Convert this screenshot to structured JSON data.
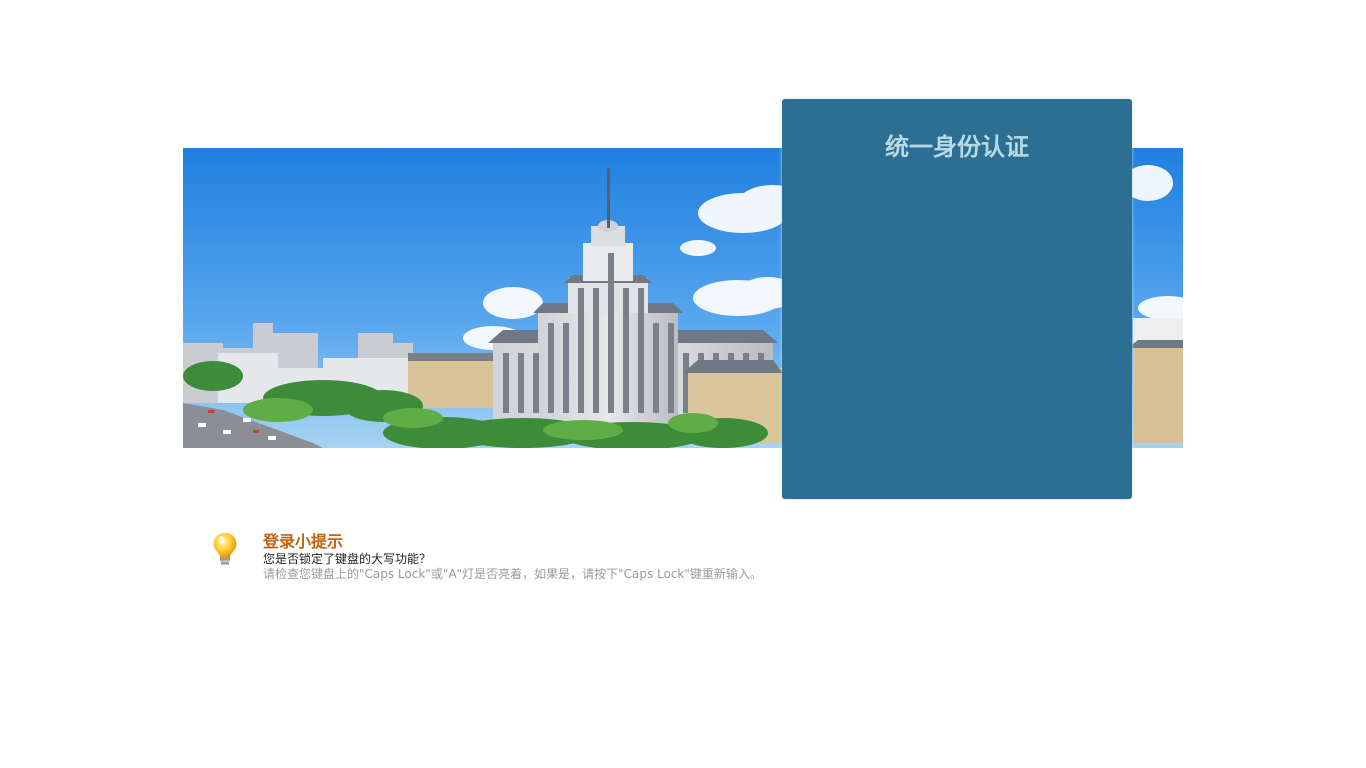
{
  "login": {
    "title": "统一身份认证"
  },
  "tips": {
    "title": "登录小提示",
    "question": "您是否锁定了键盘的大写功能？",
    "hint": "请检查您键盘上的\"Caps Lock\"或\"A\"灯是否亮着，如果是，请按下\"Caps Lock\"键重新输入。"
  },
  "colors": {
    "panel_bg": "#2d6e93",
    "title_text": "#b6dbe6",
    "tips_title": "#c1620f"
  },
  "icons": {
    "tip": "lightbulb-icon"
  }
}
